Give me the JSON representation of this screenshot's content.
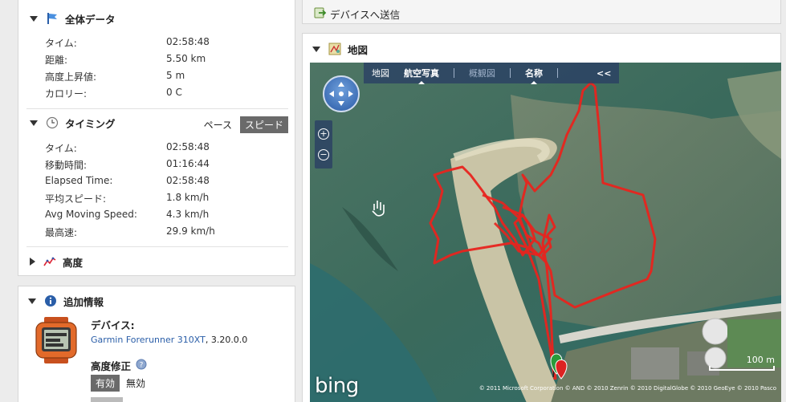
{
  "summary": {
    "title": "全体データ",
    "rows": [
      {
        "label": "タイム:",
        "value": "02:58:48"
      },
      {
        "label": "距離:",
        "value": "5.50 km"
      },
      {
        "label": "高度上昇値:",
        "value": "5 m"
      },
      {
        "label": "カロリー:",
        "value": "0 C"
      }
    ]
  },
  "timing": {
    "title": "タイミング",
    "toggle": {
      "pace": "ペース",
      "speed": "スピード"
    },
    "rows": [
      {
        "label": "タイム:",
        "value": "02:58:48"
      },
      {
        "label": "移動時間:",
        "value": "01:16:44"
      },
      {
        "label": "Elapsed Time:",
        "value": "02:58:48"
      },
      {
        "label": "平均スピード:",
        "value": "1.8 km/h"
      },
      {
        "label": "Avg Moving Speed:",
        "value": "4.3 km/h"
      },
      {
        "label": "最高速:",
        "value": "29.9 km/h"
      }
    ]
  },
  "elevation": {
    "title": "高度"
  },
  "extra": {
    "title": "追加情報",
    "device_label": "デバイス:",
    "device_name": "Garmin Forerunner 310XT",
    "device_version": ", 3.20.0.0",
    "elev_correction_label": "高度修正",
    "enabled": "有効",
    "disabled": "無効"
  },
  "send": {
    "label": "デバイスへ送信"
  },
  "map": {
    "title": "地図",
    "tabs": {
      "road": "地図",
      "aerial": "航空写真",
      "birdseye": "概観図",
      "labels": "名称",
      "collapse": "<<"
    },
    "brand": "bing",
    "scale_label": "100 m",
    "copyright": "© 2011 Microsoft Corporation  © AND  © 2010 Zenrin  © 2010 DigitalGlobe  © 2010 GeoEye  © 2010 Pasco"
  },
  "colors": {
    "track": "#e8241e",
    "sand": "#c9c4a6",
    "water": "#3b6f62",
    "accent": "#2a5ea8"
  }
}
